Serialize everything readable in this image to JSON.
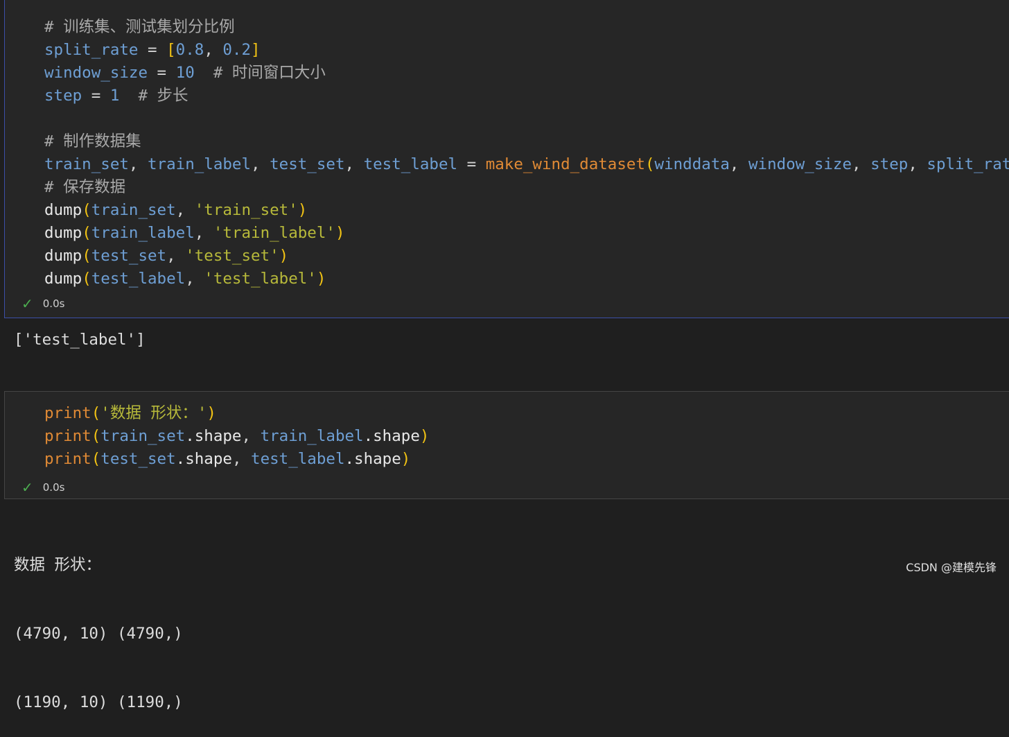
{
  "cell1": {
    "code_lines": [
      [
        {
          "t": "# 训练集、测试集划分比例",
          "c": "cm"
        }
      ],
      [
        {
          "t": "split_rate",
          "c": "var"
        },
        {
          "t": " = ",
          "c": "op"
        },
        {
          "t": "[",
          "c": "br"
        },
        {
          "t": "0.8",
          "c": "num"
        },
        {
          "t": ", ",
          "c": "op"
        },
        {
          "t": "0.2",
          "c": "num"
        },
        {
          "t": "]",
          "c": "br"
        }
      ],
      [
        {
          "t": "window_size",
          "c": "var"
        },
        {
          "t": " = ",
          "c": "op"
        },
        {
          "t": "10",
          "c": "num"
        },
        {
          "t": "  # 时间窗口大小",
          "c": "cm"
        }
      ],
      [
        {
          "t": "step",
          "c": "var"
        },
        {
          "t": " = ",
          "c": "op"
        },
        {
          "t": "1",
          "c": "num"
        },
        {
          "t": "  # 步长",
          "c": "cm"
        }
      ],
      [],
      [
        {
          "t": "# 制作数据集",
          "c": "cm"
        }
      ],
      [
        {
          "t": "train_set",
          "c": "var"
        },
        {
          "t": ", ",
          "c": "op"
        },
        {
          "t": "train_label",
          "c": "var"
        },
        {
          "t": ", ",
          "c": "op"
        },
        {
          "t": "test_set",
          "c": "var"
        },
        {
          "t": ", ",
          "c": "op"
        },
        {
          "t": "test_label",
          "c": "var"
        },
        {
          "t": " = ",
          "c": "op"
        },
        {
          "t": "make_wind_dataset",
          "c": "fn"
        },
        {
          "t": "(",
          "c": "br"
        },
        {
          "t": "winddata",
          "c": "var"
        },
        {
          "t": ", ",
          "c": "op"
        },
        {
          "t": "window_size",
          "c": "var"
        },
        {
          "t": ", ",
          "c": "op"
        },
        {
          "t": "step",
          "c": "var"
        },
        {
          "t": ", ",
          "c": "op"
        },
        {
          "t": "split_rate",
          "c": "var"
        },
        {
          "t": ")",
          "c": "br"
        }
      ],
      [
        {
          "t": "# 保存数据",
          "c": "cm"
        }
      ],
      [
        {
          "t": "dump",
          "c": "fnw"
        },
        {
          "t": "(",
          "c": "br"
        },
        {
          "t": "train_set",
          "c": "var"
        },
        {
          "t": ", ",
          "c": "op"
        },
        {
          "t": "'train_set'",
          "c": "str"
        },
        {
          "t": ")",
          "c": "br"
        }
      ],
      [
        {
          "t": "dump",
          "c": "fnw"
        },
        {
          "t": "(",
          "c": "br"
        },
        {
          "t": "train_label",
          "c": "var"
        },
        {
          "t": ", ",
          "c": "op"
        },
        {
          "t": "'train_label'",
          "c": "str"
        },
        {
          "t": ")",
          "c": "br"
        }
      ],
      [
        {
          "t": "dump",
          "c": "fnw"
        },
        {
          "t": "(",
          "c": "br"
        },
        {
          "t": "test_set",
          "c": "var"
        },
        {
          "t": ", ",
          "c": "op"
        },
        {
          "t": "'test_set'",
          "c": "str"
        },
        {
          "t": ")",
          "c": "br"
        }
      ],
      [
        {
          "t": "dump",
          "c": "fnw"
        },
        {
          "t": "(",
          "c": "br"
        },
        {
          "t": "test_label",
          "c": "var"
        },
        {
          "t": ", ",
          "c": "op"
        },
        {
          "t": "'test_label'",
          "c": "str"
        },
        {
          "t": ")",
          "c": "br"
        }
      ]
    ],
    "status_icon": "check-icon",
    "exec_time": "0.0s",
    "output": "['test_label']"
  },
  "cell2": {
    "code_lines": [
      [
        {
          "t": "print",
          "c": "fn"
        },
        {
          "t": "(",
          "c": "br"
        },
        {
          "t": "'数据 形状：'",
          "c": "str"
        },
        {
          "t": ")",
          "c": "br"
        }
      ],
      [
        {
          "t": "print",
          "c": "fn"
        },
        {
          "t": "(",
          "c": "br"
        },
        {
          "t": "train_set",
          "c": "var"
        },
        {
          "t": ".shape",
          "c": "fnw"
        },
        {
          "t": ", ",
          "c": "op"
        },
        {
          "t": "train_label",
          "c": "var"
        },
        {
          "t": ".shape",
          "c": "fnw"
        },
        {
          "t": ")",
          "c": "br"
        }
      ],
      [
        {
          "t": "print",
          "c": "fn"
        },
        {
          "t": "(",
          "c": "br"
        },
        {
          "t": "test_set",
          "c": "var"
        },
        {
          "t": ".shape",
          "c": "fnw"
        },
        {
          "t": ", ",
          "c": "op"
        },
        {
          "t": "test_label",
          "c": "var"
        },
        {
          "t": ".shape",
          "c": "fnw"
        },
        {
          "t": ")",
          "c": "br"
        }
      ]
    ],
    "status_icon": "check-icon",
    "exec_time": "0.0s",
    "output_lines": [
      "数据 形状：",
      "(4790, 10) (4790,)",
      "(1190, 10) (1190,)"
    ]
  },
  "watermark": "CSDN @建模先锋"
}
